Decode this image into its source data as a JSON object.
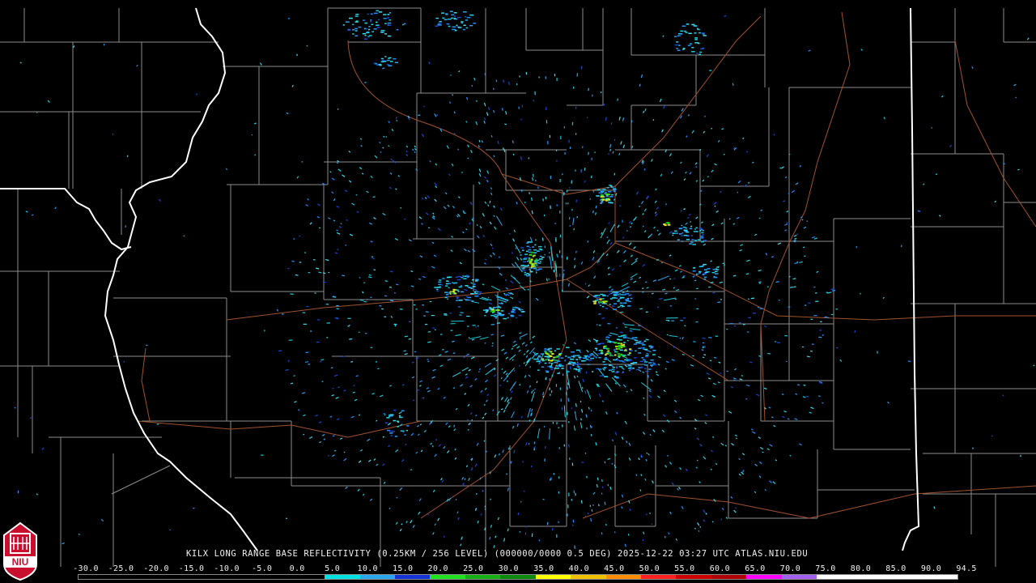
{
  "product": {
    "caption": "KILX LONG RANGE BASE REFLECTIVITY (0.25KM / 256 LEVEL) (000000/0000 0.5 DEG) 2025-12-22 03:27 UTC  ATLAS.NIU.EDU",
    "station": "KILX",
    "elevation_deg": "0.5",
    "timestamp": "2025-12-22 03:27 UTC",
    "source": "ATLAS.NIU.EDU"
  },
  "logo": {
    "icon": "niu-logo-icon",
    "text": "NIU",
    "color": "#c8102e"
  },
  "color_scale": {
    "labels": [
      "-30.0",
      "-25.0",
      "-20.0",
      "-15.0",
      "-10.0",
      "-5.0",
      "0.0",
      "5.0",
      "10.0",
      "15.0",
      "20.0",
      "25.0",
      "30.0",
      "35.0",
      "40.0",
      "45.0",
      "50.0",
      "55.0",
      "60.0",
      "65.0",
      "70.0",
      "75.0",
      "80.0",
      "85.0",
      "90.0",
      "94.5"
    ],
    "colors": [
      "#000000",
      "#000000",
      "#000000",
      "#000000",
      "#000000",
      "#000000",
      "#000000",
      "#00e0e0",
      "#2aa6f0",
      "#1434d8",
      "#20e020",
      "#16b016",
      "#0c8a0c",
      "#ffff00",
      "#f0c000",
      "#ff8c00",
      "#ff2020",
      "#d00000",
      "#b00000",
      "#ff00ff",
      "#a060f0",
      "#ffffff",
      "#ffffff",
      "#ffffff",
      "#ffffff"
    ]
  },
  "map_colors": {
    "background": "#000000",
    "county_lines": "#9a9a9a",
    "state_lines": "#ffffff",
    "highways": "#a0522d"
  }
}
